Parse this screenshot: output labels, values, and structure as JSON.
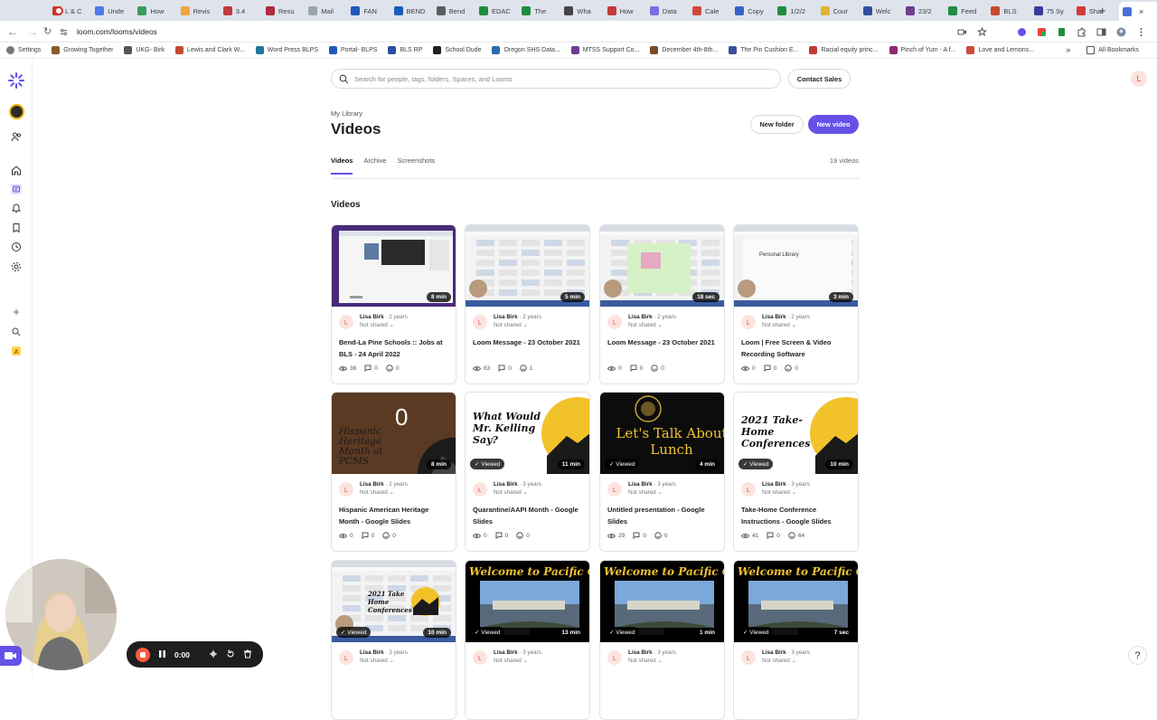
{
  "browser": {
    "tabs": [
      "L & C",
      "Unde",
      "How",
      "Revis",
      "3.4",
      "Resu",
      "Mail",
      "FAN",
      "BEND",
      "Bend",
      "EDAC",
      "The",
      "Wha",
      "How",
      "Data",
      "Cale",
      "Copy",
      "1/2/2",
      "Cour",
      "Welc",
      "23/2",
      "Feed",
      "BLS",
      "75 Sy",
      "Shar",
      ""
    ],
    "url": "loom.com/looms/videos",
    "bookmarks": [
      "Settings",
      "Growing Together",
      "UKG- Birk",
      "Lewis and Clark W...",
      "Word Press BLPS",
      "Portal- BLPS",
      "BLS RP",
      "School Dude",
      "Oregon SHS Data...",
      "MTSS Support Co...",
      "December 4th-8th...",
      "The Pin Cushion E...",
      "Racial equity princ...",
      "Pinch of Yum - A f...",
      "Love and Lemons..."
    ],
    "all_bookmarks": "All Bookmarks"
  },
  "header": {
    "search_placeholder": "Search for people, tags, folders, Spaces, and Looms",
    "contact_sales": "Contact Sales",
    "user_initial": "L"
  },
  "page": {
    "breadcrumb": "My Library",
    "title": "Videos",
    "new_folder": "New folder",
    "new_video": "New video",
    "tabs": [
      "Videos",
      "Archive",
      "Screenshots"
    ],
    "video_count": "19 videos",
    "section": "Videos"
  },
  "cards": [
    {
      "author": "Lisa Birk",
      "age": "· 2 years",
      "share": "Not shared",
      "title": "Bend-La Pine Schools :: Jobs at BLS - 24 April 2022",
      "duration": "8 min",
      "viewed": "",
      "views": "36",
      "comments": "0",
      "reactions": "0"
    },
    {
      "author": "Lisa Birk",
      "age": "· 2 years",
      "share": "Not shared",
      "title": "Loom Message - 23 October 2021",
      "duration": "5 min",
      "viewed": "",
      "views": "63",
      "comments": "0",
      "reactions": "1"
    },
    {
      "author": "Lisa Birk",
      "age": "· 2 years",
      "share": "Not shared",
      "title": "Loom Message - 23 October 2021",
      "duration": "18 sec",
      "viewed": "",
      "views": "0",
      "comments": "0",
      "reactions": "0"
    },
    {
      "author": "Lisa Birk",
      "age": "· 2 years",
      "share": "Not shared",
      "title": "Loom | Free Screen & Video Recording Software",
      "duration": "3 min",
      "viewed": "",
      "views": "0",
      "comments": "0",
      "reactions": "0"
    },
    {
      "author": "Lisa Birk",
      "age": "· 2 years",
      "share": "Not shared",
      "title": "Hispanic American Heritage Month - Google Slides",
      "duration": "8 min",
      "viewed": "",
      "views": "0",
      "comments": "0",
      "reactions": "0"
    },
    {
      "author": "Lisa Birk",
      "age": "· 3 years",
      "share": "Not shared",
      "title": "Quarantine/AAPI Month - Google Slides",
      "duration": "11 min",
      "viewed": "Viewed",
      "views": "0",
      "comments": "0",
      "reactions": "0"
    },
    {
      "author": "Lisa Birk",
      "age": "· 3 years",
      "share": "Not shared",
      "title": "Untitled presentation - Google Slides",
      "duration": "4 min",
      "viewed": "Viewed",
      "views": "29",
      "comments": "0",
      "reactions": "0"
    },
    {
      "author": "Lisa Birk",
      "age": "· 3 years",
      "share": "Not shared",
      "title": "Take-Home Conference Instructions - Google Slides",
      "duration": "10 min",
      "viewed": "Viewed",
      "views": "41",
      "comments": "0",
      "reactions": "64"
    },
    {
      "author": "Lisa Birk",
      "age": "· 3 years",
      "share": "Not shared",
      "title": "",
      "duration": "10 min",
      "viewed": "Viewed",
      "views": "",
      "comments": "",
      "reactions": ""
    },
    {
      "author": "Lisa Birk",
      "age": "· 3 years",
      "share": "Not shared",
      "title": "",
      "duration": "13 min",
      "viewed": "Viewed",
      "views": "",
      "comments": "",
      "reactions": ""
    },
    {
      "author": "Lisa Birk",
      "age": "· 3 years",
      "share": "Not shared",
      "title": "",
      "duration": "1 min",
      "viewed": "Viewed",
      "views": "",
      "comments": "",
      "reactions": ""
    },
    {
      "author": "Lisa Birk",
      "age": "· 3 years",
      "share": "Not shared",
      "title": "",
      "duration": "7 sec",
      "viewed": "Viewed",
      "views": "",
      "comments": "",
      "reactions": ""
    }
  ],
  "thumb_text": {
    "hispanic": "Hispanic Heritage Month at PCMS",
    "hispanic_big": "0",
    "kelling": "What Would Mr. Kelling Say?",
    "lunch": "Let's Talk About Lunch",
    "conferences": "2021 Take-Home Conferences",
    "conferences_small": "2021 Take Home Conferences",
    "welcome": "Welcome to Pacific Crest",
    "personal_library": "Personal Library"
  },
  "recorder": {
    "timer": "0:00"
  },
  "help": "?"
}
